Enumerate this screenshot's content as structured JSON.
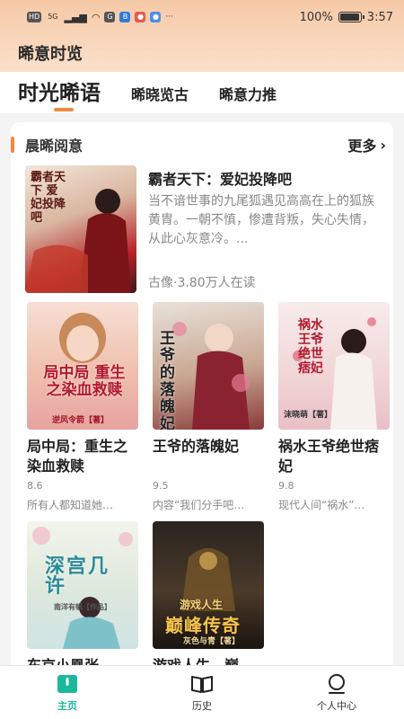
{
  "status_bar": {
    "left_chips": [
      "HD",
      "5G",
      "HD",
      "G",
      "B"
    ],
    "battery_text": "100%",
    "time": "3:57"
  },
  "app": {
    "title": "晞意时览"
  },
  "tabs": [
    {
      "label": "时光晞语",
      "active": true
    },
    {
      "label": "晞晓览古",
      "active": false
    },
    {
      "label": "晞意力推",
      "active": false
    }
  ],
  "section": {
    "title": "晨晞阅意",
    "more_label": "更多"
  },
  "featured": {
    "title": "霸者天下：爱妃投降吧",
    "description": "当不谙世事的九尾狐遇见高高在上的狐族黄胄。一朝不慎，惨遭背叛，失心失情，从此心灰意冷。...",
    "meta": "古像·3.80万人在读",
    "cover_text": "霸者天下 爱妃投降吧"
  },
  "books": [
    {
      "title": "局中局：重生之染血救赎",
      "score": "8.6",
      "desc": "所有人都知道她…",
      "cover_text": "局中局 重生之染血救赎",
      "cover_author": "逆风令箭【著】"
    },
    {
      "title": "王爷的落魄妃",
      "score": "9.5",
      "desc": "内容“我们分手吧…",
      "cover_text": "王爷的落魄妃"
    },
    {
      "title": "祸水王爷绝世痞妃",
      "score": "9.8",
      "desc": "现代人间“祸水”…",
      "cover_text": "祸水王爷 绝世痞妃",
      "cover_author": "沫晓萌【著】"
    },
    {
      "title": "",
      "score": "",
      "desc": "",
      "cover_text": "深宫几许",
      "cover_author": "南洋有帆【作品】"
    },
    {
      "title": "",
      "score": "",
      "desc": "",
      "cover_text": "巅峰传奇",
      "cover_sub": "游戏人生",
      "cover_author": "灰色与青【著】"
    }
  ],
  "partial_titles": [
    "东京小凰张",
    "游戏人生，巅"
  ],
  "nav": [
    {
      "label": "主页",
      "icon": "home-icon",
      "active": true
    },
    {
      "label": "历史",
      "icon": "book-icon",
      "active": false
    },
    {
      "label": "个人中心",
      "icon": "user-icon",
      "active": false
    }
  ],
  "colors": {
    "accent": "#f08a3c",
    "nav_active": "#1cb89c",
    "header_top": "#f6c9a6"
  }
}
